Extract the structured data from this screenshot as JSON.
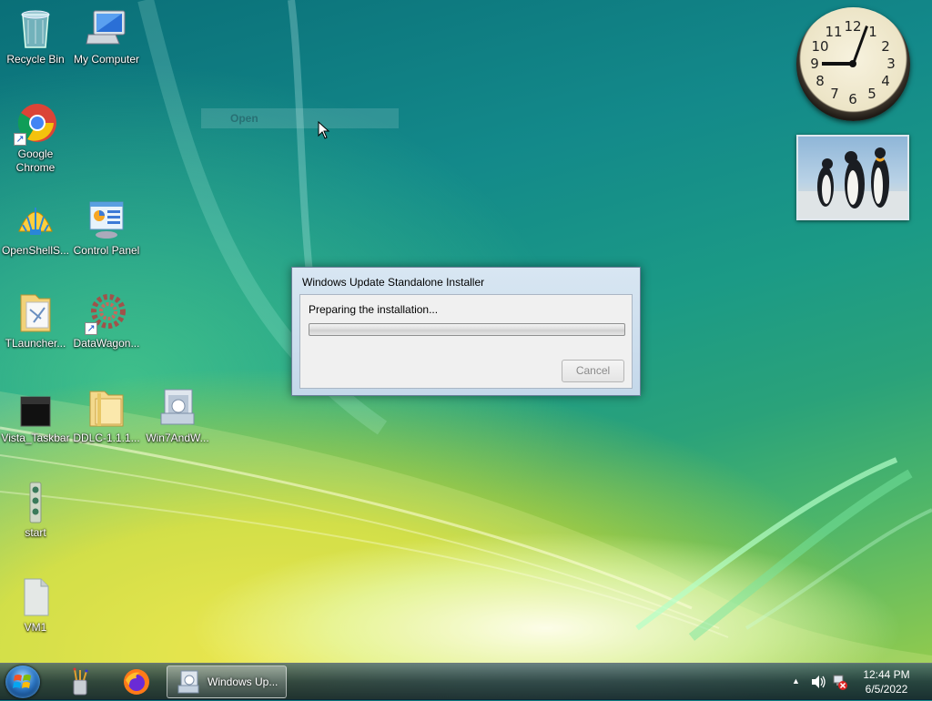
{
  "desktop": {
    "icons": [
      {
        "label": "Recycle Bin"
      },
      {
        "label": "My Computer"
      },
      {
        "label": "Google Chrome"
      },
      {
        "label": "OpenShellS..."
      },
      {
        "label": "Control Panel"
      },
      {
        "label": "TLauncher..."
      },
      {
        "label": "DataWagon..."
      },
      {
        "label": "Vista_Taskbar"
      },
      {
        "label": "DDLC-1.1.1..."
      },
      {
        "label": "Win7AndW..."
      },
      {
        "label": "start"
      },
      {
        "label": "VM1"
      }
    ],
    "ghost_menu_label": "Open"
  },
  "gadgets": {
    "clock_numbers": [
      "12",
      "1",
      "2",
      "3",
      "4",
      "5",
      "6",
      "7",
      "8",
      "9",
      "10",
      "11"
    ],
    "photo_icon": "penguins-photo"
  },
  "dialog": {
    "title": "Windows Update Standalone Installer",
    "status": "Preparing the installation...",
    "progress_fraction": 0,
    "cancel_label": "Cancel"
  },
  "taskbar": {
    "window_button_label": "Windows Up...",
    "tray_chevron": "▲",
    "time": "12:44 PM",
    "date": "6/5/2022"
  },
  "colors": {
    "accent": "#1a56c8",
    "dialog_frame": "#c4d8ea"
  }
}
